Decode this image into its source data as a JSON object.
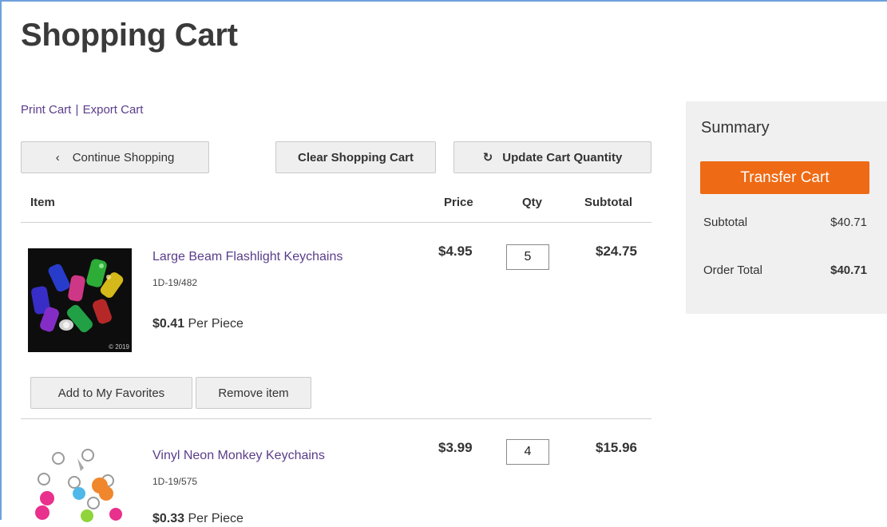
{
  "page": {
    "title": "Shopping Cart"
  },
  "links": {
    "print": "Print Cart",
    "separator": "|",
    "export": "Export Cart"
  },
  "toolbar": {
    "continue_label": "Continue Shopping",
    "continue_icon": "chevron-left-icon",
    "clear_label": "Clear Shopping Cart",
    "update_label": "Update Cart Quantity",
    "update_icon": "refresh-icon"
  },
  "table": {
    "headers": {
      "item": "Item",
      "price": "Price",
      "qty": "Qty",
      "subtotal": "Subtotal"
    }
  },
  "items": [
    {
      "name": "Large Beam Flashlight Keychains",
      "sku": "1D-19/482",
      "unit_price": "$0.41",
      "unit_label": "Per Piece",
      "price": "$4.95",
      "qty": "5",
      "subtotal": "$24.75",
      "copyright": "© 2019",
      "favorite_label": "Add to My Favorites",
      "remove_label": "Remove item"
    },
    {
      "name": "Vinyl Neon Monkey Keychains",
      "sku": "1D-19/575",
      "unit_price": "$0.33",
      "unit_label": "Per Piece",
      "price": "$3.99",
      "qty": "4",
      "subtotal": "$15.96"
    }
  ],
  "summary": {
    "title": "Summary",
    "transfer_label": "Transfer Cart",
    "subtotal_label": "Subtotal",
    "subtotal_value": "$40.71",
    "total_label": "Order Total",
    "total_value": "$40.71"
  },
  "colors": {
    "accent": "#ef6a14",
    "link": "#5a3d8a",
    "panel_bg": "#f0f0f0",
    "window_border": "#6fa0dc"
  }
}
